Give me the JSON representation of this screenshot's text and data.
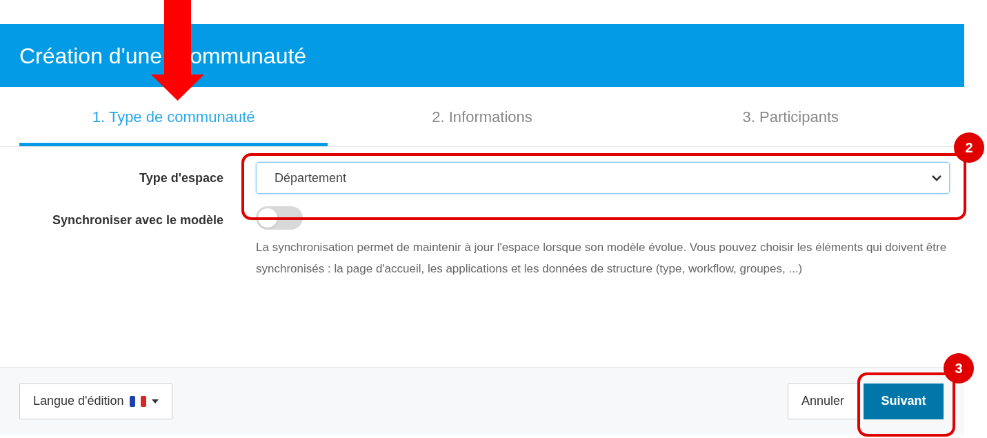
{
  "dialog": {
    "title": "Création d'une",
    "title_continued": "ommunauté"
  },
  "tabs": [
    {
      "label": "1. Type de communauté",
      "selected": true
    },
    {
      "label": "2. Informations",
      "selected": false
    },
    {
      "label": "3. Participants",
      "selected": false
    }
  ],
  "form": {
    "space_type": {
      "label": "Type d'espace",
      "value": "Département"
    },
    "sync": {
      "label": "Synchroniser avec le modèle",
      "on": false,
      "help": "La synchronisation permet de maintenir à jour l'espace lorsque son modèle évolue. Vous pouvez choisir les éléments qui doivent être synchronisés : la page d'accueil, les applications et les données de structure (type, workflow, groupes, ...)"
    }
  },
  "footer": {
    "language_button": "Langue d'édition",
    "cancel_button": "Annuler",
    "next_button": "Suivant"
  },
  "annotations": [
    {
      "kind": "arrow"
    },
    {
      "kind": "badge",
      "label": "2"
    },
    {
      "kind": "badge",
      "label": "3"
    }
  ]
}
